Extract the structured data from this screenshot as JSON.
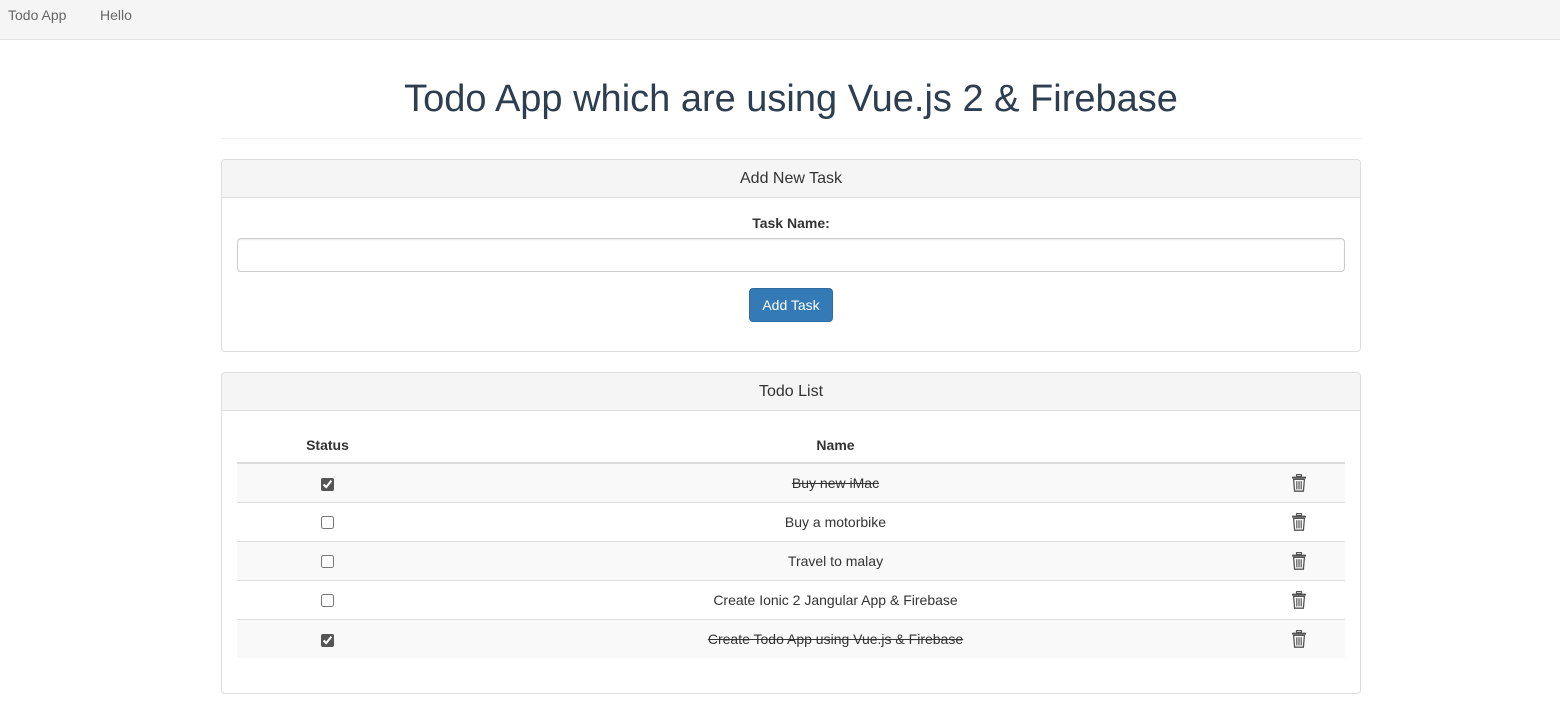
{
  "navbar": {
    "brand": "Todo App",
    "link": "Hello"
  },
  "page": {
    "title": "Todo App which are using Vue.js 2 & Firebase"
  },
  "add_panel": {
    "heading": "Add New Task",
    "label": "Task Name:",
    "input_value": "",
    "button_label": "Add Task"
  },
  "list_panel": {
    "heading": "Todo List",
    "columns": [
      "Status",
      "Name",
      ""
    ],
    "rows": [
      {
        "name": "Buy new iMac",
        "done": true,
        "icon": "trash-icon"
      },
      {
        "name": "Buy a motorbike",
        "done": false,
        "icon": "trash-icon"
      },
      {
        "name": "Travel to malay",
        "done": false,
        "icon": "trash-icon"
      },
      {
        "name": "Create Ionic 2 Jangular App & Firebase",
        "done": false,
        "icon": "trash-icon"
      },
      {
        "name": "Create Todo App using Vue.js & Firebase",
        "done": true,
        "icon": "trash-icon"
      }
    ]
  },
  "colors": {
    "primary": "#337ab7",
    "title": "#2c3e50",
    "navbar_bg": "#f5f5f5",
    "panel_heading_bg": "#f5f5f5",
    "stripe_bg": "#f9f9f9"
  }
}
